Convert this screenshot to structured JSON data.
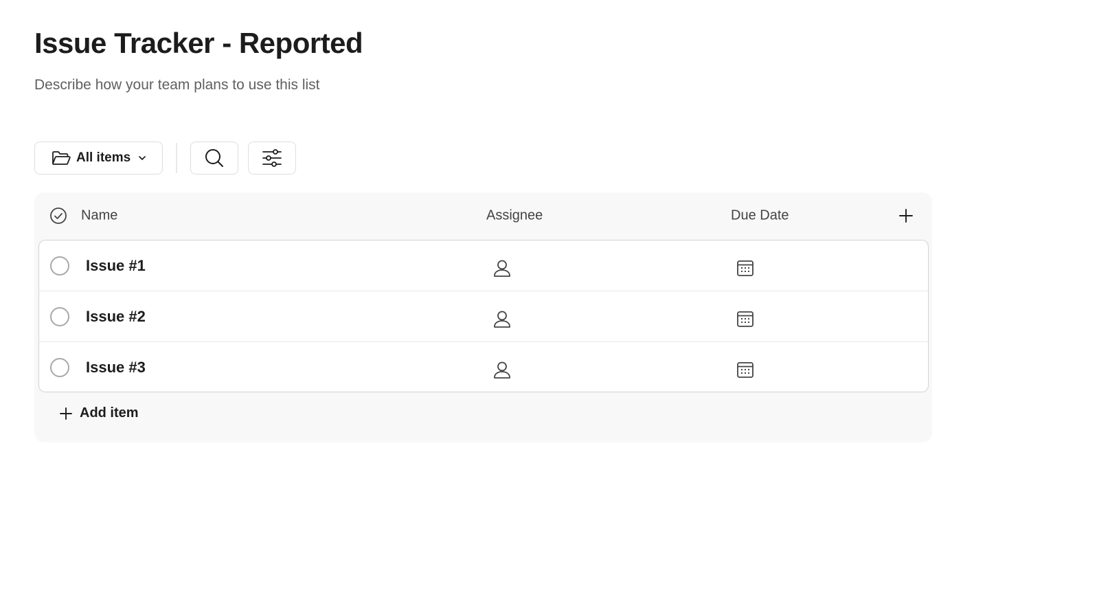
{
  "page": {
    "title": "Issue Tracker - Reported",
    "description": "Describe how your team plans to use this list"
  },
  "toolbar": {
    "view_label": "All items",
    "view_icon": "folder-icon",
    "search_icon": "search-icon",
    "filter_icon": "sliders-icon"
  },
  "list": {
    "columns": [
      {
        "label": "Name"
      },
      {
        "label": "Assignee"
      },
      {
        "label": "Due Date"
      }
    ],
    "rows": [
      {
        "name": "Issue #1"
      },
      {
        "name": "Issue #2"
      },
      {
        "name": "Issue #3"
      }
    ],
    "add_item_label": "Add item"
  },
  "colors": {
    "title_text": "#1d1c1d",
    "secondary_text": "#616061",
    "card_background": "#f8f8f8",
    "border": "#d3d3d3"
  }
}
